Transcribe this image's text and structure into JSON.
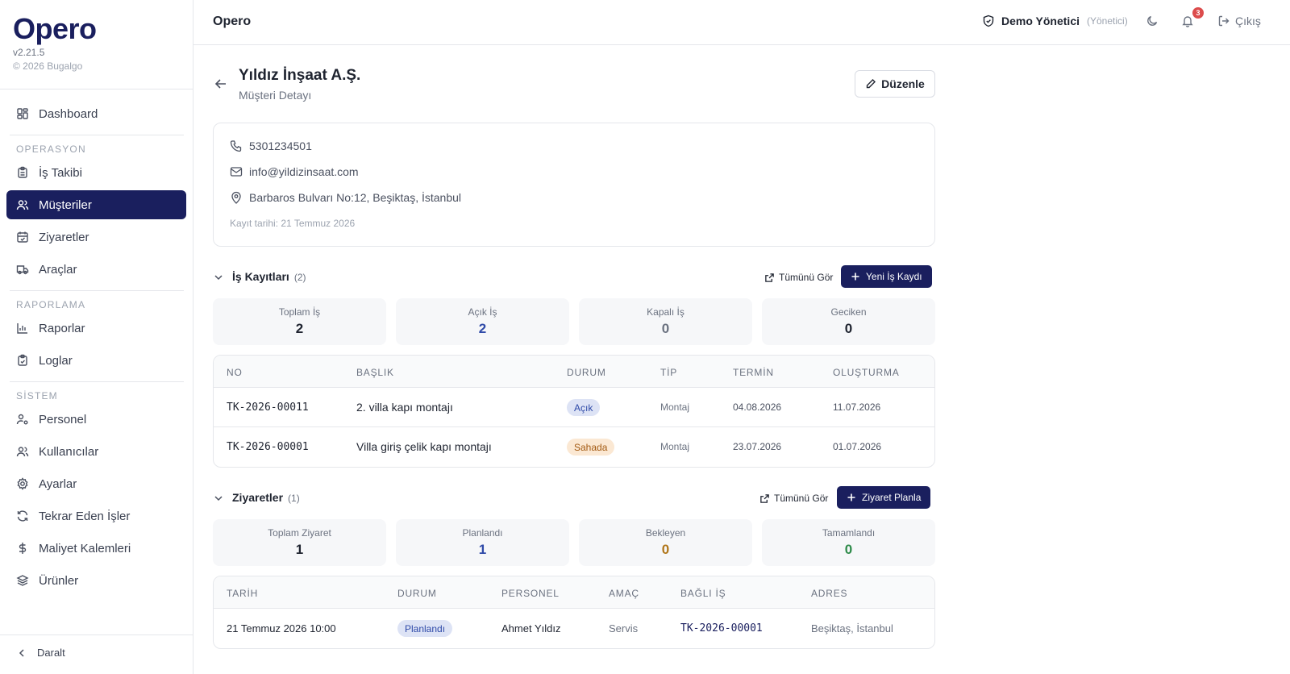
{
  "brand": {
    "name": "Opero",
    "version": "v2.21.5",
    "copyright": "© 2026 Bugalgo"
  },
  "sidebar": {
    "dashboard": "Dashboard",
    "sections": {
      "operasyon": "OPERASYON",
      "raporlama": "RAPORLAMA",
      "sistem": "SİSTEM"
    },
    "items": {
      "is_takibi": "İş Takibi",
      "musteriler": "Müşteriler",
      "ziyaretler": "Ziyaretler",
      "araclar": "Araçlar",
      "raporlar": "Raporlar",
      "loglar": "Loglar",
      "personel": "Personel",
      "kullanicilar": "Kullanıcılar",
      "ayarlar": "Ayarlar",
      "tekrar_eden": "Tekrar Eden İşler",
      "maliyet": "Maliyet Kalemleri",
      "urunler": "Ürünler"
    },
    "collapse": "Daralt"
  },
  "topbar": {
    "title": "Opero",
    "user": "Demo Yönetici",
    "role": "(Yönetici)",
    "notifications": "3",
    "logout": "Çıkış"
  },
  "customer": {
    "name": "Yıldız İnşaat A.Ş.",
    "subtitle": "Müşteri Detayı",
    "edit": "Düzenle",
    "phone": "5301234501",
    "email": "info@yildizinsaat.com",
    "address": "Barbaros Bulvarı No:12, Beşiktaş, İstanbul",
    "registered": "Kayıt tarihi: 21 Temmuz 2026"
  },
  "jobs": {
    "title": "İş Kayıtları",
    "count": "(2)",
    "view_all": "Tümünü Gör",
    "new": "Yeni İş Kaydı",
    "stats": [
      {
        "label": "Toplam İş",
        "value": "2",
        "color": "#1f2430"
      },
      {
        "label": "Açık İş",
        "value": "2",
        "color": "#2f4aa8"
      },
      {
        "label": "Kapalı İş",
        "value": "0",
        "color": "#6b7280"
      },
      {
        "label": "Geciken",
        "value": "0",
        "color": "#1f2430"
      }
    ],
    "columns": [
      "NO",
      "BAŞLIK",
      "DURUM",
      "TİP",
      "TERMİN",
      "OLUŞTURMA"
    ],
    "rows": [
      {
        "no": "TK-2026-00011",
        "title": "2. villa kapı montajı",
        "status": "Açık",
        "type": "Montaj",
        "due": "04.08.2026",
        "created": "11.07.2026"
      },
      {
        "no": "TK-2026-00001",
        "title": "Villa giriş çelik kapı montajı",
        "status": "Sahada",
        "type": "Montaj",
        "due": "23.07.2026",
        "created": "01.07.2026"
      }
    ],
    "status_colors": {
      "open_bg": "#dde3f5",
      "open_fg": "#2f4aa8",
      "field_bg": "#fbe8d3",
      "field_fg": "#a35a12"
    }
  },
  "visits": {
    "title": "Ziyaretler",
    "count": "(1)",
    "view_all": "Tümünü Gör",
    "new": "Ziyaret Planla",
    "stats": [
      {
        "label": "Toplam Ziyaret",
        "value": "1",
        "color": "#1f2430"
      },
      {
        "label": "Planlandı",
        "value": "1",
        "color": "#2f4aa8"
      },
      {
        "label": "Bekleyen",
        "value": "0",
        "color": "#b0761a"
      },
      {
        "label": "Tamamlandı",
        "value": "0",
        "color": "#2e8b4a"
      }
    ],
    "columns": [
      "TARİH",
      "DURUM",
      "PERSONEL",
      "AMAÇ",
      "BAĞLI İŞ",
      "ADRES"
    ],
    "rows": [
      {
        "date": "21 Temmuz 2026 10:00",
        "status": "Planlandı",
        "staff": "Ahmet Yıldız",
        "purpose": "Servis",
        "job": "TK-2026-00001",
        "address": "Beşiktaş, İstanbul"
      }
    ]
  },
  "colors": {
    "brand": "#1a1f5e",
    "accent": "#22b8a8",
    "badge": "#dc4c4c"
  }
}
